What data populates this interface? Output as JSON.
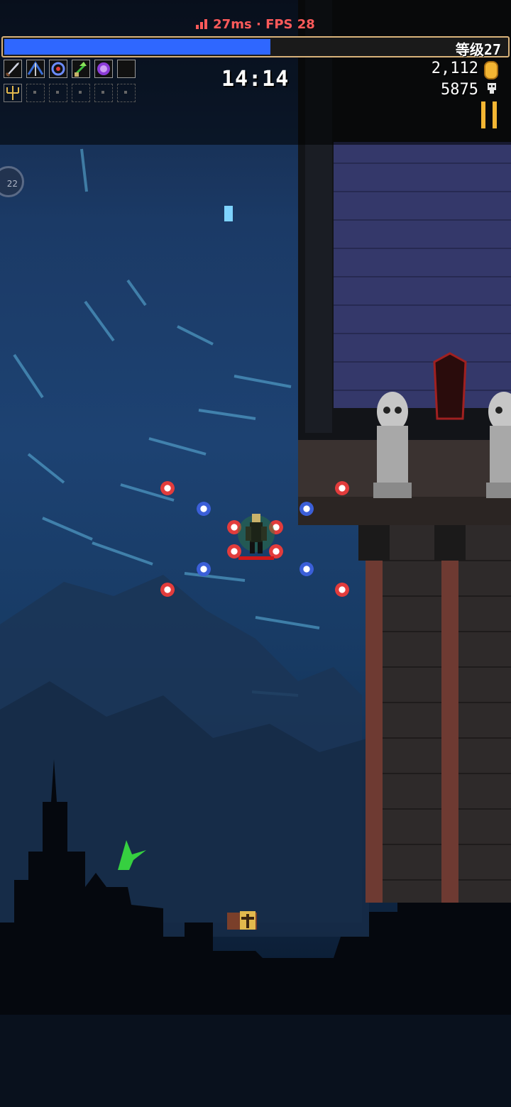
{
  "hud": {
    "network": {
      "latency": "27ms",
      "separator": " · ",
      "fps_label": "FPS 28"
    },
    "experience": {
      "progress": 0.53,
      "level_label": "等级27"
    },
    "timer": "14:14",
    "gold": "2,112",
    "kills": "5875",
    "weapons": [
      "sword-icon",
      "crossbow-icon",
      "ring-icon",
      "herb-icon",
      "magic-orb-icon",
      "empty-slot"
    ],
    "passives": [
      "trident-icon",
      "empty-slot",
      "empty-slot",
      "empty-slot",
      "empty-slot",
      "empty-slot"
    ],
    "side_badge": "22"
  },
  "colors": {
    "accent": "#f3b533",
    "xp_fill": "#2f67ff",
    "network_text": "#ff5a5a"
  }
}
